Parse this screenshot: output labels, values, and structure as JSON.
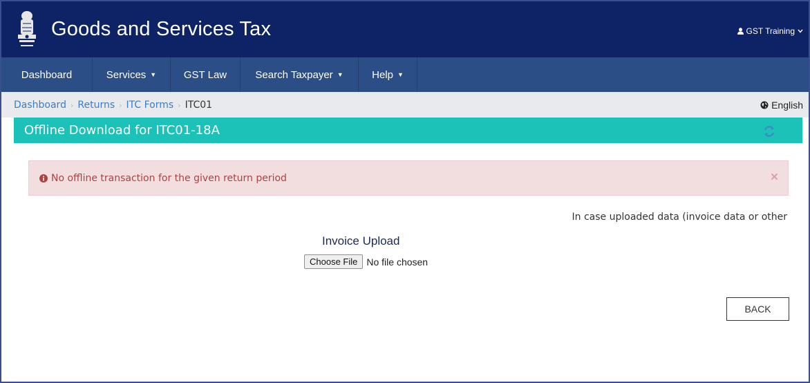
{
  "header": {
    "title": "Goods and Services Tax",
    "user_name": "GST Training",
    "emblem_icon": "national-emblem-icon"
  },
  "nav": {
    "items": [
      {
        "label": "Dashboard",
        "has_dropdown": false
      },
      {
        "label": "Services",
        "has_dropdown": true
      },
      {
        "label": "GST Law",
        "has_dropdown": false
      },
      {
        "label": "Search Taxpayer",
        "has_dropdown": true
      },
      {
        "label": "Help",
        "has_dropdown": true
      }
    ]
  },
  "breadcrumb": {
    "items": [
      "Dashboard",
      "Returns",
      "ITC Forms"
    ],
    "current": "ITC01"
  },
  "language": {
    "label": "English",
    "icon": "globe-icon"
  },
  "panel": {
    "title": "Offline Download for ITC01-18A",
    "refresh_icon": "refresh-icon"
  },
  "alert": {
    "message": "No offline transaction for the given return period",
    "icon": "info-circle-icon",
    "close_label": "×"
  },
  "info_note": "In case uploaded data (invoice data or other",
  "upload": {
    "label": "Invoice Upload",
    "button_label": "Choose File",
    "status": "No file chosen"
  },
  "back_label": "BACK",
  "colors": {
    "header_bg": "#0d2366",
    "nav_bg": "#2c4e86",
    "panel_header": "#1cc1b7",
    "alert_bg": "#f2dede",
    "alert_text": "#a94442"
  }
}
